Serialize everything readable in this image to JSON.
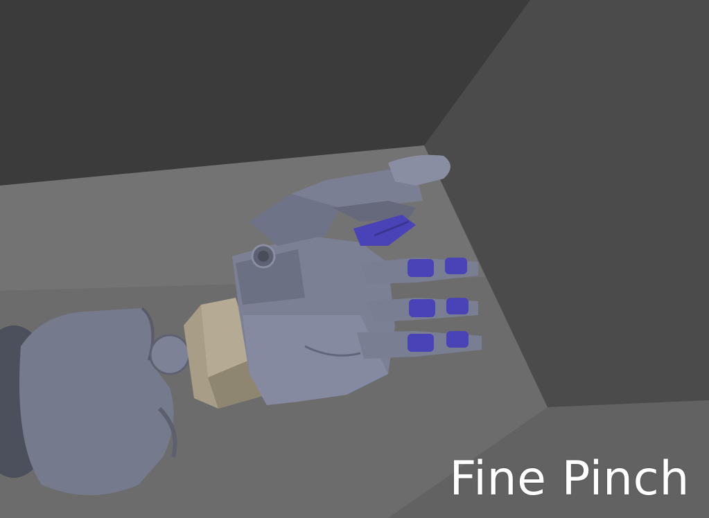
{
  "caption": "Fine Pinch",
  "colors": {
    "wall_dark": "#3b3b3b",
    "wall_right": "#4a4a4a",
    "floor": "#6b6b6b",
    "floor_far": "#7a7a7a",
    "hand_metal": "#7b7f93",
    "hand_shadow": "#5a5d6e",
    "joint_purple": "#4a43b8",
    "wrist_tan": "#a79c86",
    "caption_text": "#ffffff"
  },
  "icons": {
    "scene": "robotic-hand-render"
  }
}
